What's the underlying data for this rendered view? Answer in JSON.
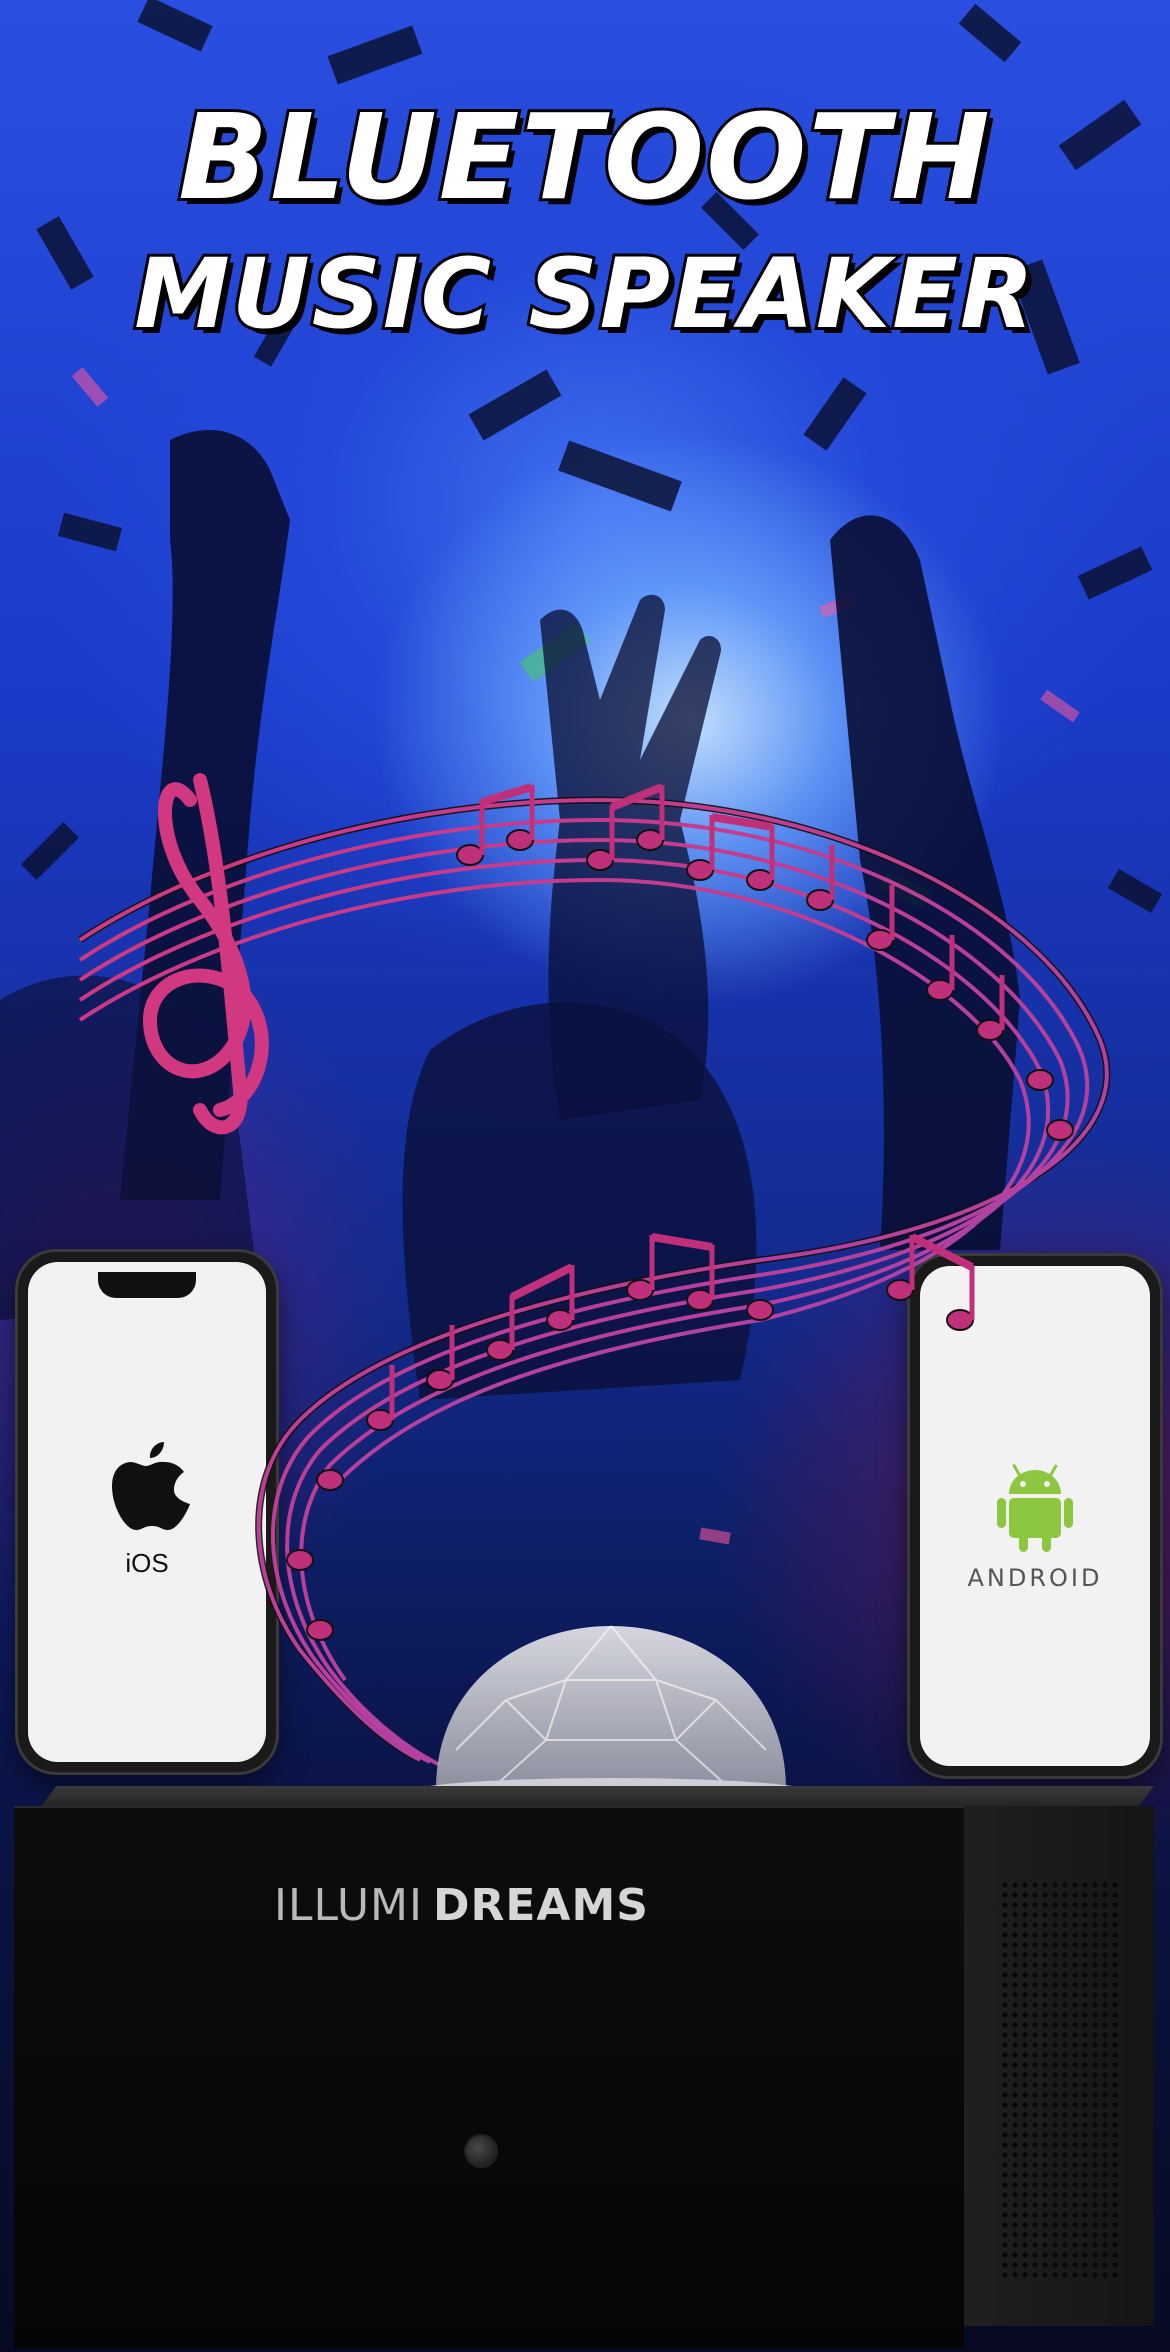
{
  "title": {
    "line1": "BLUETOOTH",
    "line2": "MUSIC SPEAKER"
  },
  "phones": {
    "ios": {
      "label": "iOS",
      "icon": "apple-icon"
    },
    "android": {
      "label": "ANDROID",
      "icon": "android-robot-icon"
    }
  },
  "speaker": {
    "brand_light": "ILLUMI",
    "brand_bold": "DREAMS"
  },
  "colors": {
    "notes": "#c0307a",
    "android_green": "#8dc63f",
    "background_blue": "#2448d8"
  }
}
